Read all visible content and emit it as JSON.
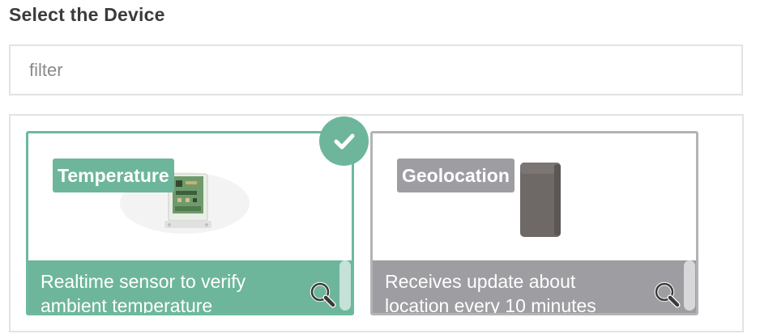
{
  "header": {
    "title": "Select the Device"
  },
  "filter": {
    "placeholder": "filter",
    "value": ""
  },
  "devices": [
    {
      "label": "Temperature",
      "description": "Realtime sensor to verify ambient temperature",
      "selected": true,
      "image_icon": "pcb-sensor-icon",
      "action_icon": "magnifier-icon"
    },
    {
      "label": "Geolocation",
      "description": "Receives update about location every 10 minutes",
      "selected": false,
      "image_icon": "gps-tracker-icon",
      "action_icon": "magnifier-icon"
    }
  ],
  "selection_badge_icon": "checkmark-icon",
  "colors": {
    "selected_accent": "#6db69b",
    "unselected_accent": "#9d9da2",
    "border": "#e3e3e3",
    "title_text": "#3b3b3b"
  }
}
